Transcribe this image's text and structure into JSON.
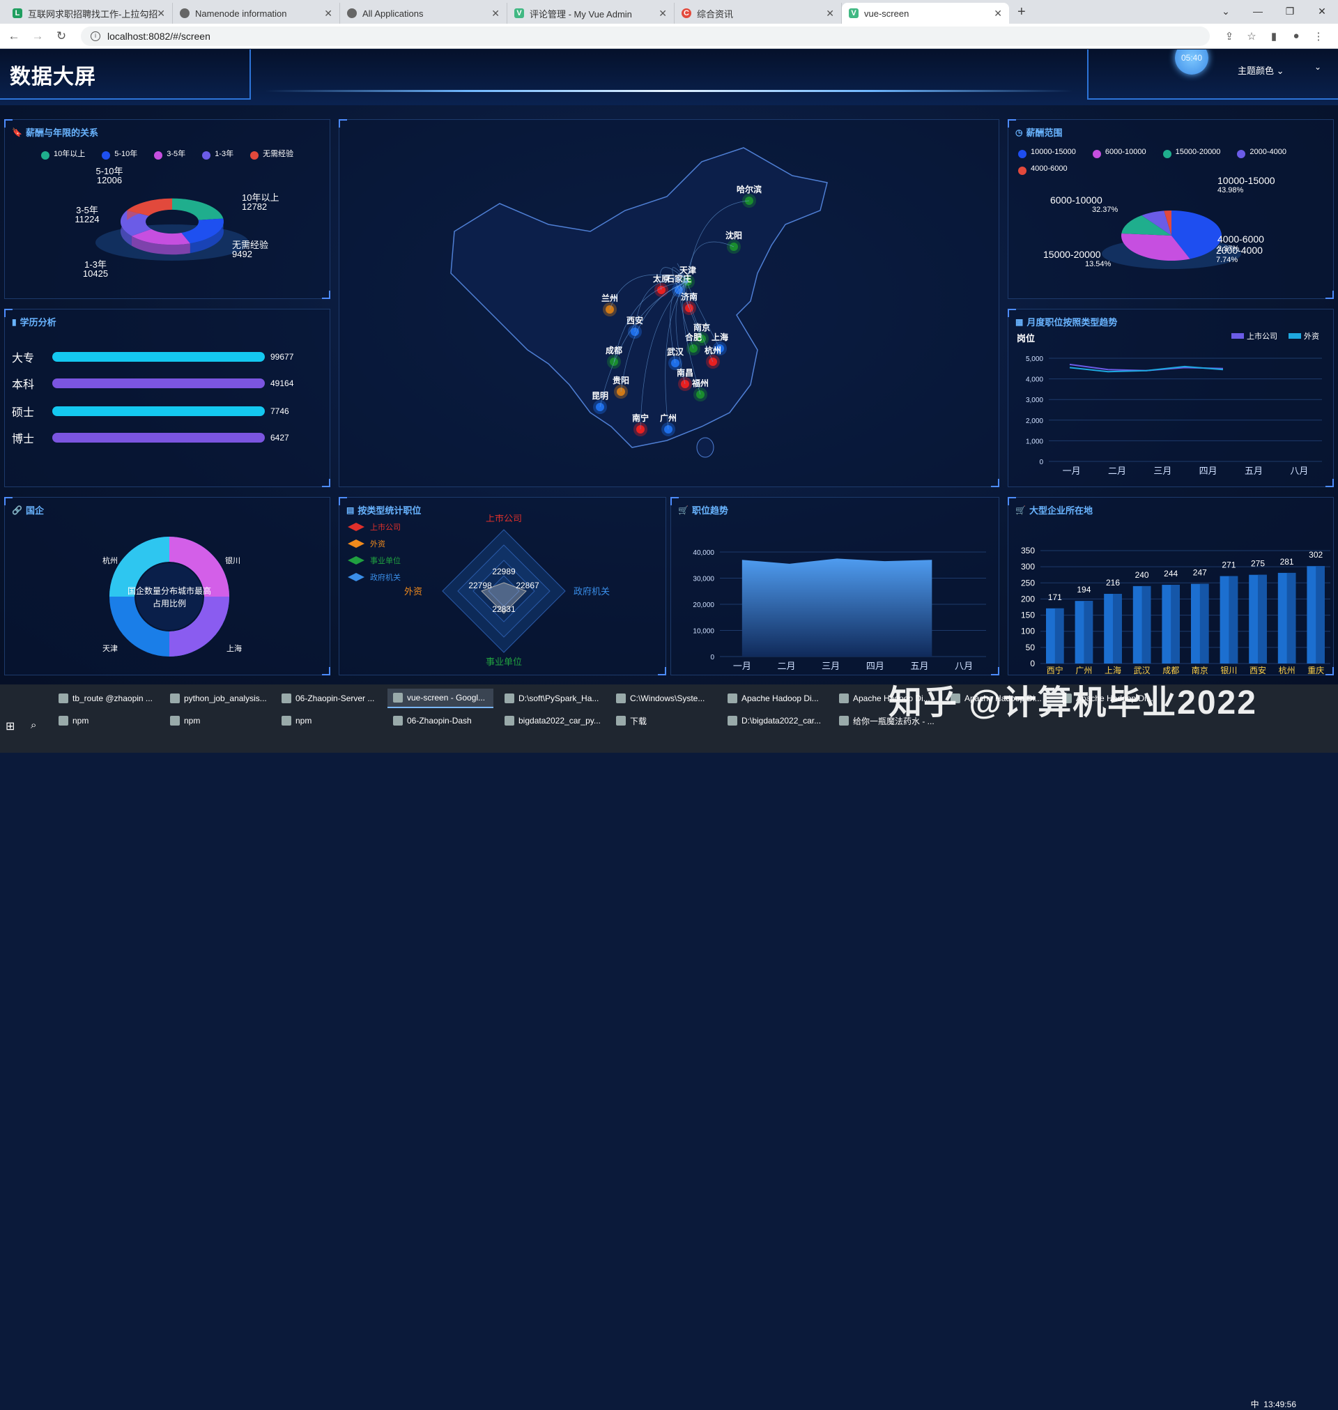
{
  "browser": {
    "tabs": [
      {
        "label": "互联网求职招聘找工作-上拉勾招",
        "icon": "lagou-icon"
      },
      {
        "label": "Namenode information",
        "icon": "globe-icon"
      },
      {
        "label": "All Applications",
        "icon": "globe-icon"
      },
      {
        "label": "评论管理 - My Vue Admin",
        "icon": "vue-icon"
      },
      {
        "label": "综合资讯",
        "icon": "c-icon"
      },
      {
        "label": "vue-screen",
        "icon": "vue-icon"
      }
    ],
    "url": "localhost:8082/#/screen"
  },
  "header": {
    "title": "数据大屏",
    "clock": "05:40",
    "theme_label": "主题颜色"
  },
  "panels": {
    "salary_years": {
      "title": "薪酬与年限的关系",
      "legend": [
        "10年以上",
        "5-10年",
        "3-5年",
        "1-3年",
        "无需经验"
      ],
      "colors": [
        "#1fae8d",
        "#1e50f0",
        "#c64fe0",
        "#6b5ce7",
        "#e2493c"
      ],
      "labels": [
        {
          "name": "5-10年",
          "value": "12006"
        },
        {
          "name": "10年以上",
          "value": "12782"
        },
        {
          "name": "3-5年",
          "value": "11224"
        },
        {
          "name": "1-3年",
          "value": "10425"
        },
        {
          "name": "无需经验",
          "value": "9492"
        }
      ]
    },
    "education": {
      "title": "学历分析",
      "rows": [
        {
          "label": "大专",
          "value": "99677",
          "color": "#14c8f0"
        },
        {
          "label": "本科",
          "value": "49164",
          "color": "#7b55e0"
        },
        {
          "label": "硕士",
          "value": "7746",
          "color": "#14c8f0"
        },
        {
          "label": "博士",
          "value": "6427",
          "color": "#7b55e0"
        }
      ]
    },
    "soe": {
      "title": "国企",
      "center": [
        "国企数量分布城市最高",
        "占用比例"
      ],
      "cities": [
        "杭州",
        "银川",
        "天津",
        "上海"
      ]
    },
    "salary_range": {
      "title": "薪酬范围",
      "legend": [
        "10000-15000",
        "6000-10000",
        "15000-20000",
        "2000-4000",
        "4000-6000"
      ],
      "colors": [
        "#1e4ef0",
        "#c64fe0",
        "#1fae8d",
        "#6b5ce7",
        "#e2493c"
      ],
      "labels": [
        {
          "name": "10000-15000",
          "pct": "43.98%"
        },
        {
          "name": "6000-10000",
          "pct": "32.37%"
        },
        {
          "name": "4000-6000",
          "pct": "2.37%"
        },
        {
          "name": "2000-4000",
          "pct": "7.74%"
        },
        {
          "name": "15000-20000",
          "pct": "13.54%"
        }
      ]
    },
    "monthly": {
      "title": "月度职位按照类型趋势",
      "ylabel": "岗位",
      "legend": [
        "上市公司",
        "外资"
      ]
    },
    "type_stats": {
      "title": "按类型统计职位",
      "legend": [
        "上市公司",
        "外资",
        "事业单位",
        "政府机关"
      ],
      "axes": [
        "上市公司",
        "外资",
        "政府机关",
        "事业单位"
      ],
      "values": [
        "22989",
        "22798",
        "22867",
        "22831"
      ]
    },
    "job_trend": {
      "title": "职位趋势"
    },
    "big_companies": {
      "title": "大型企业所在地"
    }
  },
  "map": {
    "cities": [
      "哈尔滨",
      "沈阳",
      "天津",
      "太原",
      "石家庄",
      "济南",
      "兰州",
      "西安",
      "南京",
      "合肥",
      "上海",
      "成都",
      "武汉",
      "杭州",
      "南昌",
      "贵阳",
      "福州",
      "昆明",
      "南宁",
      "广州"
    ]
  },
  "chart_data": [
    {
      "type": "pie",
      "title": "薪酬与年限的关系",
      "labels": [
        "10年以上",
        "5-10年",
        "3-5年",
        "1-3年",
        "无需经验"
      ],
      "values": [
        12782,
        12006,
        11224,
        10425,
        9492
      ]
    },
    {
      "type": "bar",
      "title": "学历分析",
      "categories": [
        "大专",
        "本科",
        "硕士",
        "博士"
      ],
      "values": [
        99677,
        49164,
        7746,
        6427
      ]
    },
    {
      "type": "pie",
      "title": "薪酬范围",
      "labels": [
        "10000-15000",
        "6000-10000",
        "15000-20000",
        "2000-4000",
        "4000-6000"
      ],
      "values": [
        43.98,
        32.37,
        13.54,
        7.74,
        2.37
      ]
    },
    {
      "type": "line",
      "title": "月度职位按照类型趋势",
      "ylabel": "岗位",
      "categories": [
        "一月",
        "二月",
        "三月",
        "四月",
        "五月",
        "八月"
      ],
      "series": [
        {
          "name": "上市公司",
          "values": [
            4700,
            4450,
            4400,
            4550,
            4500,
            4650
          ],
          "color": "#6b5ce7"
        },
        {
          "name": "外资",
          "values": [
            4550,
            4350,
            4400,
            4600,
            4450,
            4700
          ],
          "color": "#1ea8e0"
        }
      ],
      "ylim": [
        0,
        5000
      ],
      "yticks": [
        0,
        1000,
        2000,
        3000,
        4000,
        5000
      ]
    },
    {
      "type": "area",
      "title": "职位趋势",
      "categories": [
        "一月",
        "二月",
        "三月",
        "四月",
        "五月",
        "八月"
      ],
      "values": [
        37000,
        35500,
        37500,
        36500,
        37000
      ],
      "ylim": [
        0,
        40000
      ],
      "yticks": [
        0,
        10000,
        20000,
        30000,
        40000
      ]
    },
    {
      "type": "bar",
      "title": "大型企业所在地",
      "categories": [
        "西宁",
        "广州",
        "上海",
        "武汉",
        "成都",
        "南京",
        "银川",
        "西安",
        "杭州",
        "重庆"
      ],
      "values": [
        171,
        194,
        216,
        240,
        244,
        247,
        271,
        275,
        281,
        302
      ],
      "ylim": [
        0,
        350
      ],
      "yticks": [
        0,
        50,
        100,
        150,
        200,
        250,
        300,
        350
      ]
    }
  ],
  "taskbar": {
    "row1": [
      "tb_route @zhaopin ...",
      "python_job_analysis...",
      "06-Zhaopin-Server ...",
      "vue-screen - Googl...",
      "D:\\soft\\PySpark_Ha...",
      "C:\\Windows\\Syste...",
      "Apache Hadoop Di...",
      "Apache Hadoop Di...",
      "Apache Hadoop Di...",
      "Apache Hadoop Di..."
    ],
    "row2": [
      "npm",
      "npm",
      "npm",
      "06-Zhaopin-Dash",
      "bigdata2022_car_py...",
      "下载",
      "D:\\bigdata2022_car...",
      "给你一瓶魔法药水 - ..."
    ],
    "time": "13:49:56",
    "ime": "中"
  },
  "watermark": "知乎 @计算机毕业2022"
}
